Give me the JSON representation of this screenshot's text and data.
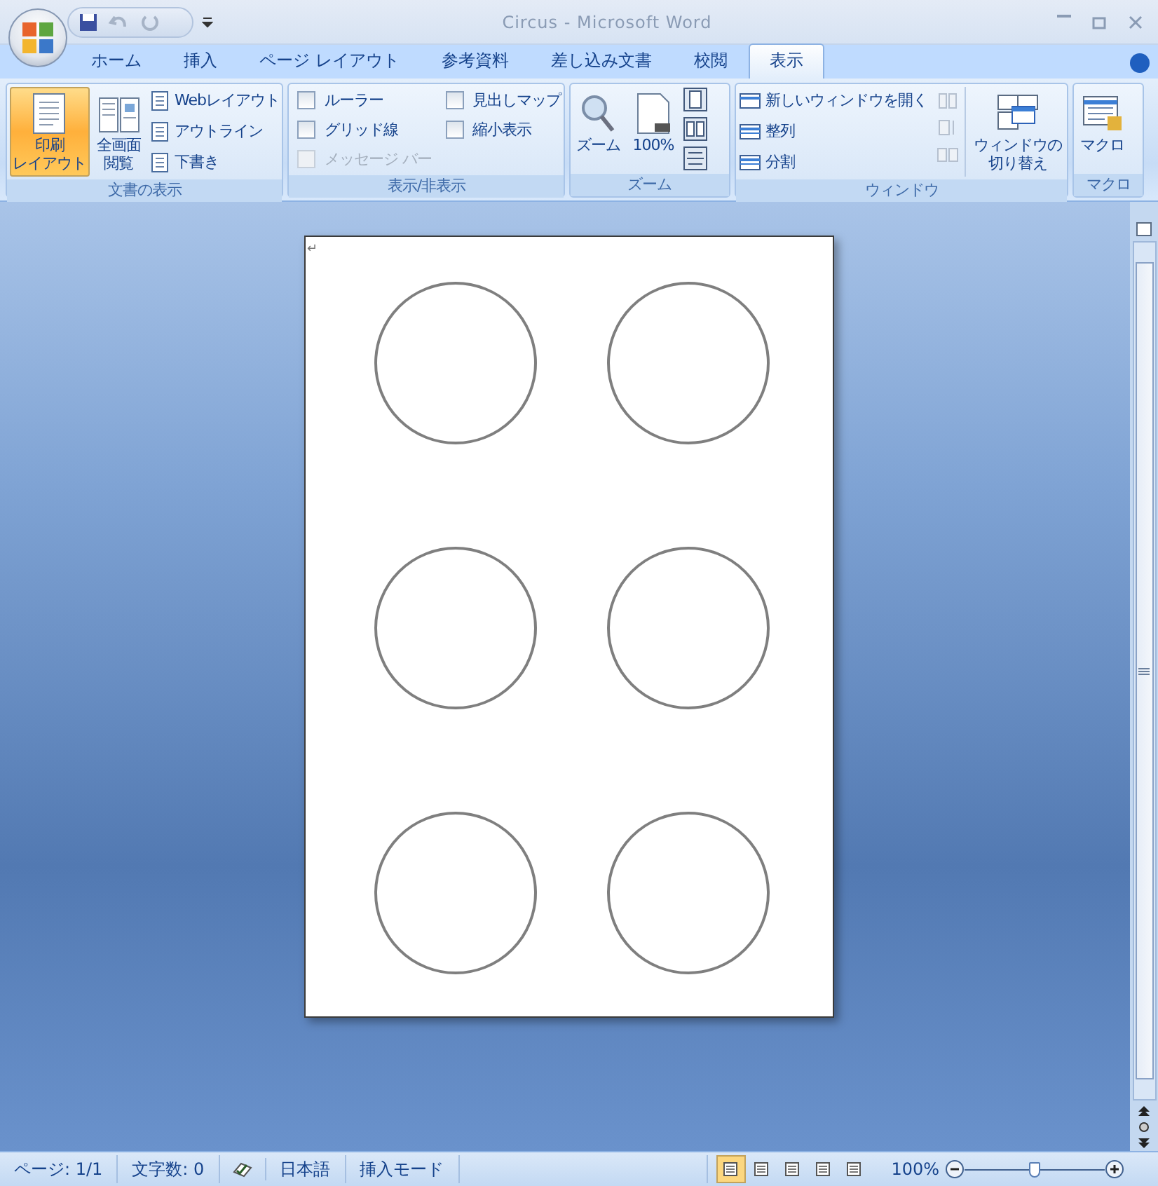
{
  "window": {
    "title": "Circus - Microsoft Word"
  },
  "tabs": [
    {
      "label": "ホーム",
      "selected": false
    },
    {
      "label": "挿入",
      "selected": false
    },
    {
      "label": "ページ レイアウト",
      "selected": false
    },
    {
      "label": "参考資料",
      "selected": false
    },
    {
      "label": "差し込み文書",
      "selected": false
    },
    {
      "label": "校閲",
      "selected": false
    },
    {
      "label": "表示",
      "selected": true
    }
  ],
  "ribbon": {
    "views": {
      "label": "文書の表示",
      "large": [
        {
          "lines": [
            "印刷",
            "レイアウト"
          ],
          "selected": true
        },
        {
          "lines": [
            "全画面",
            "閲覧"
          ],
          "selected": false
        }
      ],
      "small": [
        "Webレイアウト",
        "アウトライン",
        "下書き"
      ]
    },
    "show_hide": {
      "label": "表示/非表示",
      "checkboxes": [
        {
          "label": "ルーラー",
          "checked": false,
          "disabled": false
        },
        {
          "label": "見出しマップ",
          "checked": false,
          "disabled": false
        },
        {
          "label": "グリッド線",
          "checked": false,
          "disabled": false
        },
        {
          "label": "縮小表示",
          "checked": false,
          "disabled": false
        },
        {
          "label": "メッセージ バー",
          "checked": false,
          "disabled": true
        }
      ]
    },
    "zoom": {
      "label": "ズーム",
      "buttons": [
        "ズーム",
        "100%"
      ]
    },
    "window": {
      "label": "ウィンドウ",
      "small": [
        "新しいウィンドウを開く",
        "整列",
        "分割"
      ],
      "switch_lines": [
        "ウィンドウの",
        "切り替え"
      ]
    },
    "macro": {
      "label": "マクロ",
      "button": "マクロ"
    }
  },
  "document": {
    "paragraph_mark": "↵",
    "shapes": [
      {
        "kind": "circle"
      },
      {
        "kind": "circle"
      },
      {
        "kind": "circle"
      },
      {
        "kind": "circle"
      },
      {
        "kind": "circle"
      },
      {
        "kind": "circle"
      }
    ]
  },
  "status_bar": {
    "items": [
      "ページ: 1/1",
      "文字数: 0",
      "日本語",
      "挿入モード"
    ],
    "views": [
      {
        "selected": true
      },
      {
        "selected": false
      },
      {
        "selected": false
      },
      {
        "selected": false
      },
      {
        "selected": false
      }
    ],
    "zoom": "100%",
    "zoom_slider": {
      "level": 0.5
    }
  }
}
